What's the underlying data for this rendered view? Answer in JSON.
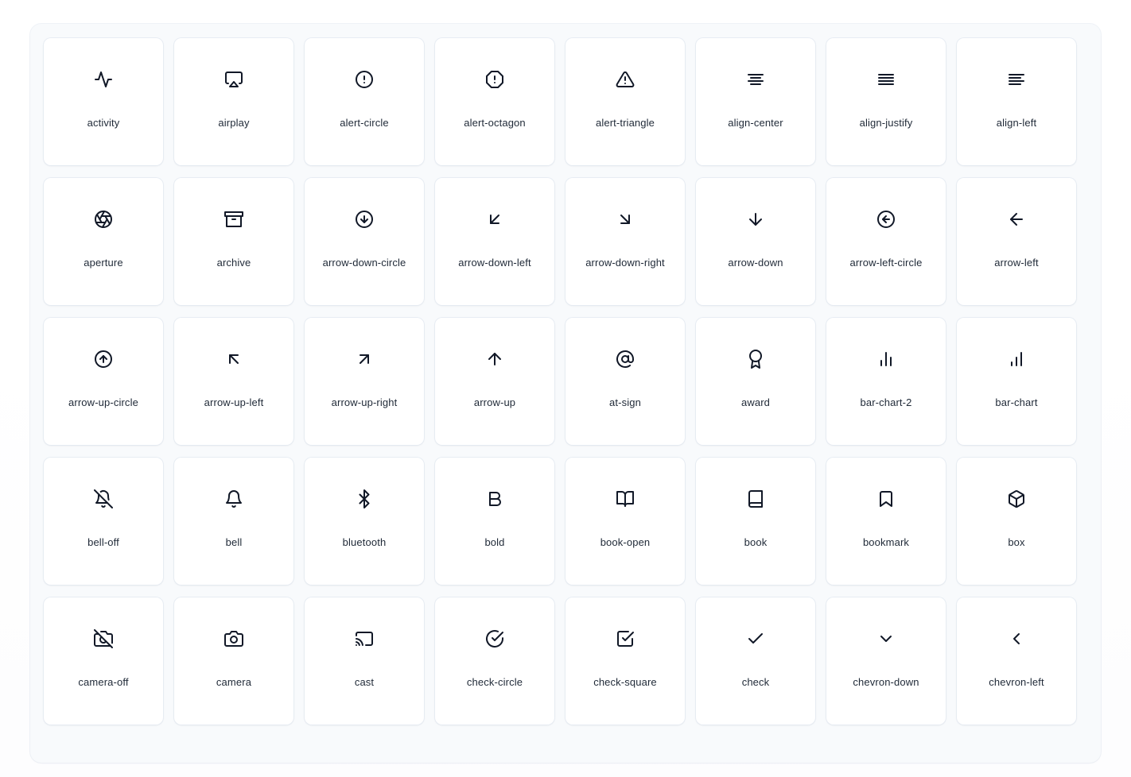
{
  "gallery": {
    "background_color": "#f8fafc",
    "card_color": "#ffffff",
    "icon_color": "#111827",
    "label_color": "#1f2937",
    "columns": 8,
    "rows": 5,
    "icons": [
      {
        "name": "activity",
        "glyph": "activity"
      },
      {
        "name": "airplay",
        "glyph": "airplay"
      },
      {
        "name": "alert-circle",
        "glyph": "alert-circle"
      },
      {
        "name": "alert-octagon",
        "glyph": "alert-octagon"
      },
      {
        "name": "alert-triangle",
        "glyph": "alert-triangle"
      },
      {
        "name": "align-center",
        "glyph": "align-center"
      },
      {
        "name": "align-justify",
        "glyph": "align-justify"
      },
      {
        "name": "align-left",
        "glyph": "align-left"
      },
      {
        "name": "aperture",
        "glyph": "aperture"
      },
      {
        "name": "archive",
        "glyph": "archive"
      },
      {
        "name": "arrow-down-circle",
        "glyph": "arrow-down-circle"
      },
      {
        "name": "arrow-down-left",
        "glyph": "arrow-down-left"
      },
      {
        "name": "arrow-down-right",
        "glyph": "arrow-down-right"
      },
      {
        "name": "arrow-down",
        "glyph": "arrow-down"
      },
      {
        "name": "arrow-left-circle",
        "glyph": "arrow-left-circle"
      },
      {
        "name": "arrow-left",
        "glyph": "arrow-left"
      },
      {
        "name": "arrow-up-circle",
        "glyph": "arrow-up-circle"
      },
      {
        "name": "arrow-up-left",
        "glyph": "arrow-up-left"
      },
      {
        "name": "arrow-up-right",
        "glyph": "arrow-up-right"
      },
      {
        "name": "arrow-up",
        "glyph": "arrow-up"
      },
      {
        "name": "at-sign",
        "glyph": "at-sign"
      },
      {
        "name": "award",
        "glyph": "award"
      },
      {
        "name": "bar-chart-2",
        "glyph": "bar-chart-2"
      },
      {
        "name": "bar-chart",
        "glyph": "bar-chart"
      },
      {
        "name": "bell-off",
        "glyph": "bell-off"
      },
      {
        "name": "bell",
        "glyph": "bell"
      },
      {
        "name": "bluetooth",
        "glyph": "bluetooth"
      },
      {
        "name": "bold",
        "glyph": "bold"
      },
      {
        "name": "book-open",
        "glyph": "book-open"
      },
      {
        "name": "book",
        "glyph": "book"
      },
      {
        "name": "bookmark",
        "glyph": "bookmark"
      },
      {
        "name": "box",
        "glyph": "box"
      },
      {
        "name": "camera-off",
        "glyph": "camera-off"
      },
      {
        "name": "camera",
        "glyph": "camera"
      },
      {
        "name": "cast",
        "glyph": "cast"
      },
      {
        "name": "check-circle",
        "glyph": "check-circle"
      },
      {
        "name": "check-square",
        "glyph": "check-square"
      },
      {
        "name": "check",
        "glyph": "check"
      },
      {
        "name": "chevron-down",
        "glyph": "chevron-down"
      },
      {
        "name": "chevron-left",
        "glyph": "chevron-left"
      }
    ]
  }
}
